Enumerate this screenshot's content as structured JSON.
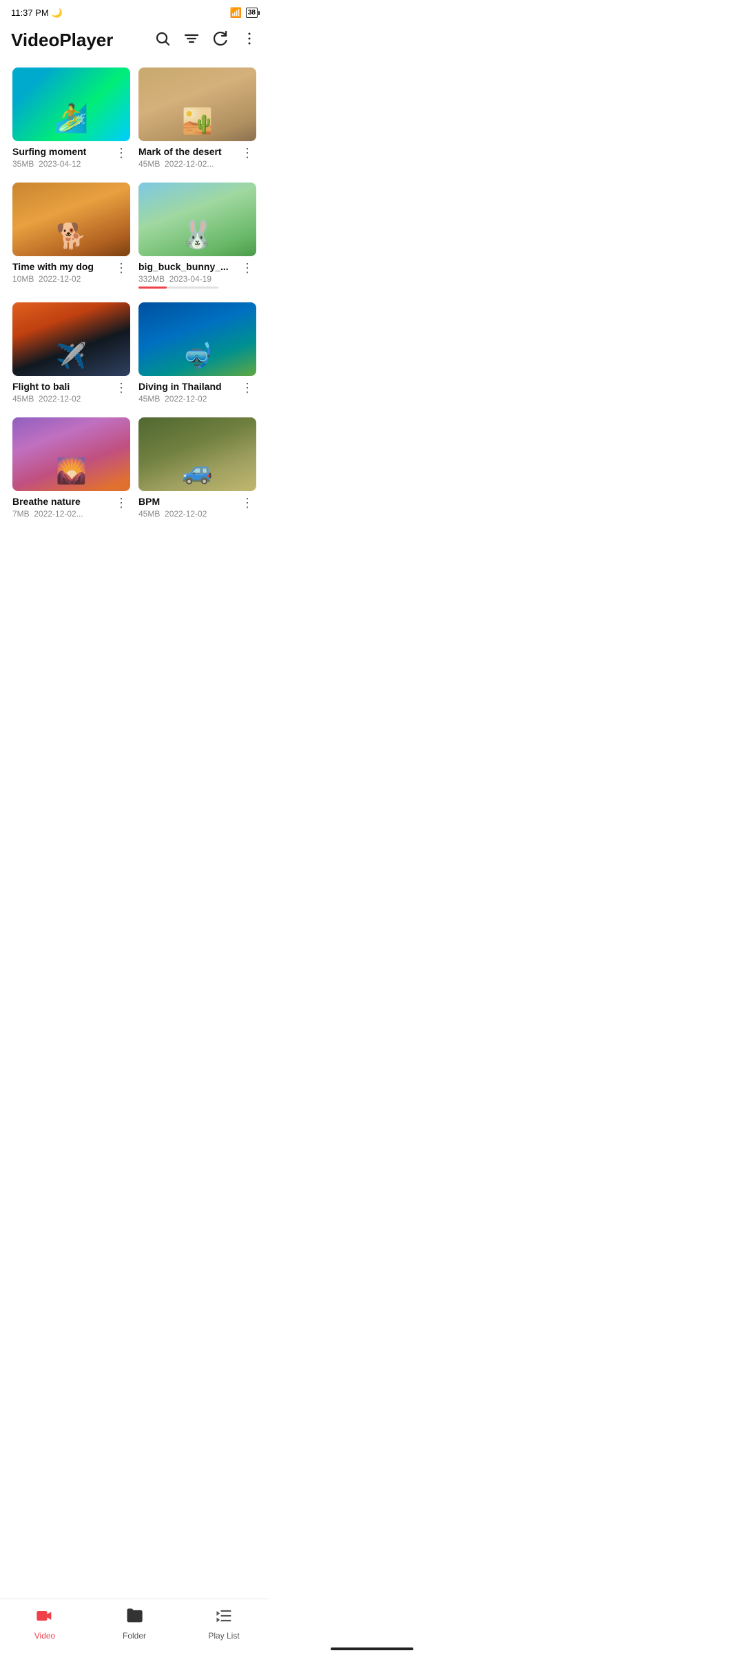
{
  "statusBar": {
    "time": "11:37 PM",
    "battery": "38"
  },
  "header": {
    "title": "VideoPlayer",
    "searchIconLabel": "search",
    "filterIconLabel": "filter",
    "refreshIconLabel": "refresh",
    "moreIconLabel": "more"
  },
  "videos": [
    {
      "id": "surfing",
      "title": "Surfing moment",
      "size": "35MB",
      "date": "2023-04-12",
      "thumbClass": "thumb-surf",
      "progress": null
    },
    {
      "id": "desert",
      "title": "Mark of the desert",
      "size": "45MB",
      "date": "2022-12-02...",
      "thumbClass": "thumb-desert",
      "progress": null
    },
    {
      "id": "dog",
      "title": "Time with my dog",
      "size": "10MB",
      "date": "2022-12-02",
      "thumbClass": "thumb-dog",
      "progress": null
    },
    {
      "id": "bunny",
      "title": "big_buck_bunny_...",
      "size": "332MB",
      "date": "2023-04-19",
      "thumbClass": "thumb-bunny",
      "progress": 35
    },
    {
      "id": "flight",
      "title": "Flight to bali",
      "size": "45MB",
      "date": "2022-12-02",
      "thumbClass": "thumb-flight",
      "progress": null
    },
    {
      "id": "diving",
      "title": "Diving in Thailand",
      "size": "45MB",
      "date": "2022-12-02",
      "thumbClass": "thumb-diving",
      "progress": null
    },
    {
      "id": "nature",
      "title": "Breathe nature",
      "size": "7MB",
      "date": "2022-12-02...",
      "thumbClass": "thumb-nature",
      "progress": null
    },
    {
      "id": "bpm",
      "title": "BPM",
      "size": "45MB",
      "date": "2022-12-02",
      "thumbClass": "thumb-bpm",
      "progress": null
    }
  ],
  "bottomNav": {
    "items": [
      {
        "id": "video",
        "label": "Video",
        "icon": "🎥",
        "active": true
      },
      {
        "id": "folder",
        "label": "Folder",
        "icon": "📁",
        "active": false
      },
      {
        "id": "playlist",
        "label": "Play List",
        "icon": "▶",
        "active": false
      }
    ]
  }
}
